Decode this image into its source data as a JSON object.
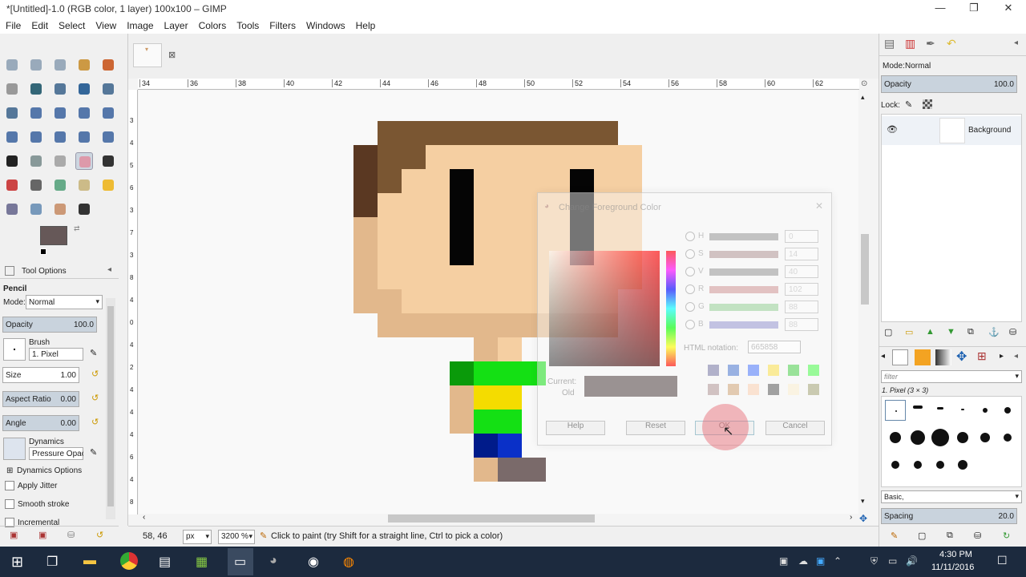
{
  "window": {
    "title": "*[Untitled]-1.0 (RGB color, 1 layer) 100x100 – GIMP",
    "minimize": "—",
    "maximize": "❐",
    "close": "✕"
  },
  "menu": [
    "File",
    "Edit",
    "Select",
    "View",
    "Image",
    "Layer",
    "Colors",
    "Tools",
    "Filters",
    "Windows",
    "Help"
  ],
  "ruler_h_ticks": [
    "34",
    "36",
    "38",
    "40",
    "42",
    "44",
    "46",
    "48",
    "50",
    "52",
    "54",
    "56",
    "58",
    "60",
    "62"
  ],
  "ruler_v_ticks": [
    "3",
    "4",
    "5",
    "6",
    "3",
    "7",
    "3",
    "8",
    "4",
    "0",
    "4",
    "2",
    "4",
    "4",
    "4",
    "6",
    "4",
    "8"
  ],
  "tool_options": {
    "header": "Tool Options",
    "tool_name": "Pencil",
    "mode_label": "Mode:",
    "mode_value": "Normal",
    "opacity_label": "Opacity",
    "opacity_value": "100.0",
    "brush_label": "Brush",
    "brush_value": "1. Pixel",
    "size_label": "Size",
    "size_value": "1.00",
    "aspect_label": "Aspect Ratio",
    "aspect_value": "0.00",
    "angle_label": "Angle",
    "angle_value": "0.00",
    "dynamics_label": "Dynamics",
    "dynamics_value": "Pressure Opacit",
    "dynamics_options": "Dynamics Options",
    "apply_jitter": "Apply Jitter",
    "smooth_stroke": "Smooth stroke",
    "incremental": "Incremental"
  },
  "dialog": {
    "title": "Change Foreground Color",
    "rows": [
      {
        "label": "H",
        "value": "0"
      },
      {
        "label": "S",
        "value": "14"
      },
      {
        "label": "V",
        "value": "40"
      },
      {
        "label": "R",
        "value": "102"
      },
      {
        "label": "G",
        "value": "88"
      },
      {
        "label": "B",
        "value": "88"
      }
    ],
    "html_label": "HTML notation:",
    "html_value": "665858",
    "current_label": "Current:",
    "old_label": "Old",
    "help": "Help",
    "reset": "Reset",
    "ok": "OK",
    "cancel": "Cancel"
  },
  "status": {
    "coords": "58, 46",
    "unit": "px",
    "zoom": "3200 %",
    "message": "Click to paint (try Shift for a straight line, Ctrl to pick a color)"
  },
  "layers": {
    "mode_label": "Mode:",
    "mode_value": "Normal",
    "opacity_label": "Opacity",
    "opacity_value": "100.0",
    "lock_label": "Lock:",
    "layer_name": "Background"
  },
  "brushes": {
    "filter_placeholder": "filter",
    "current": "1. Pixel (3 × 3)",
    "preset": "Basic,",
    "spacing_label": "Spacing",
    "spacing_value": "20.0"
  },
  "taskbar": {
    "time": "4:30 PM",
    "date": "11/11/2016"
  },
  "colors": {
    "foreground": "#665858",
    "accent_bar": "#c9d3dd"
  }
}
